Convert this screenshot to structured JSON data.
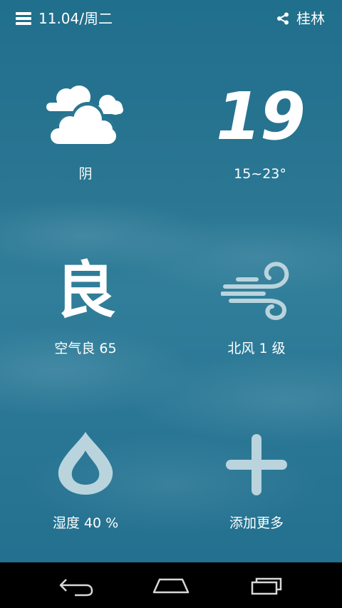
{
  "header": {
    "date": "11.04/周二",
    "city": "桂林"
  },
  "tiles": {
    "weather": {
      "label": "阴",
      "icon": "cloudy-icon"
    },
    "temperature": {
      "current": "19",
      "range": "15~23°"
    },
    "air": {
      "char": "良",
      "label": "空气良 65"
    },
    "wind": {
      "label": "北风 1 级",
      "icon": "wind-icon"
    },
    "humidity": {
      "label": "湿度 40 %",
      "icon": "water-drop-icon"
    },
    "add": {
      "label": "添加更多",
      "icon": "plus-icon"
    }
  },
  "navbar": {
    "buttons": [
      "back-icon",
      "home-icon",
      "recent-apps-icon"
    ]
  },
  "colors": {
    "background": "#2a7693",
    "icon_tint": "#b9d4dd",
    "text": "#ffffff",
    "navbar": "#000000"
  }
}
